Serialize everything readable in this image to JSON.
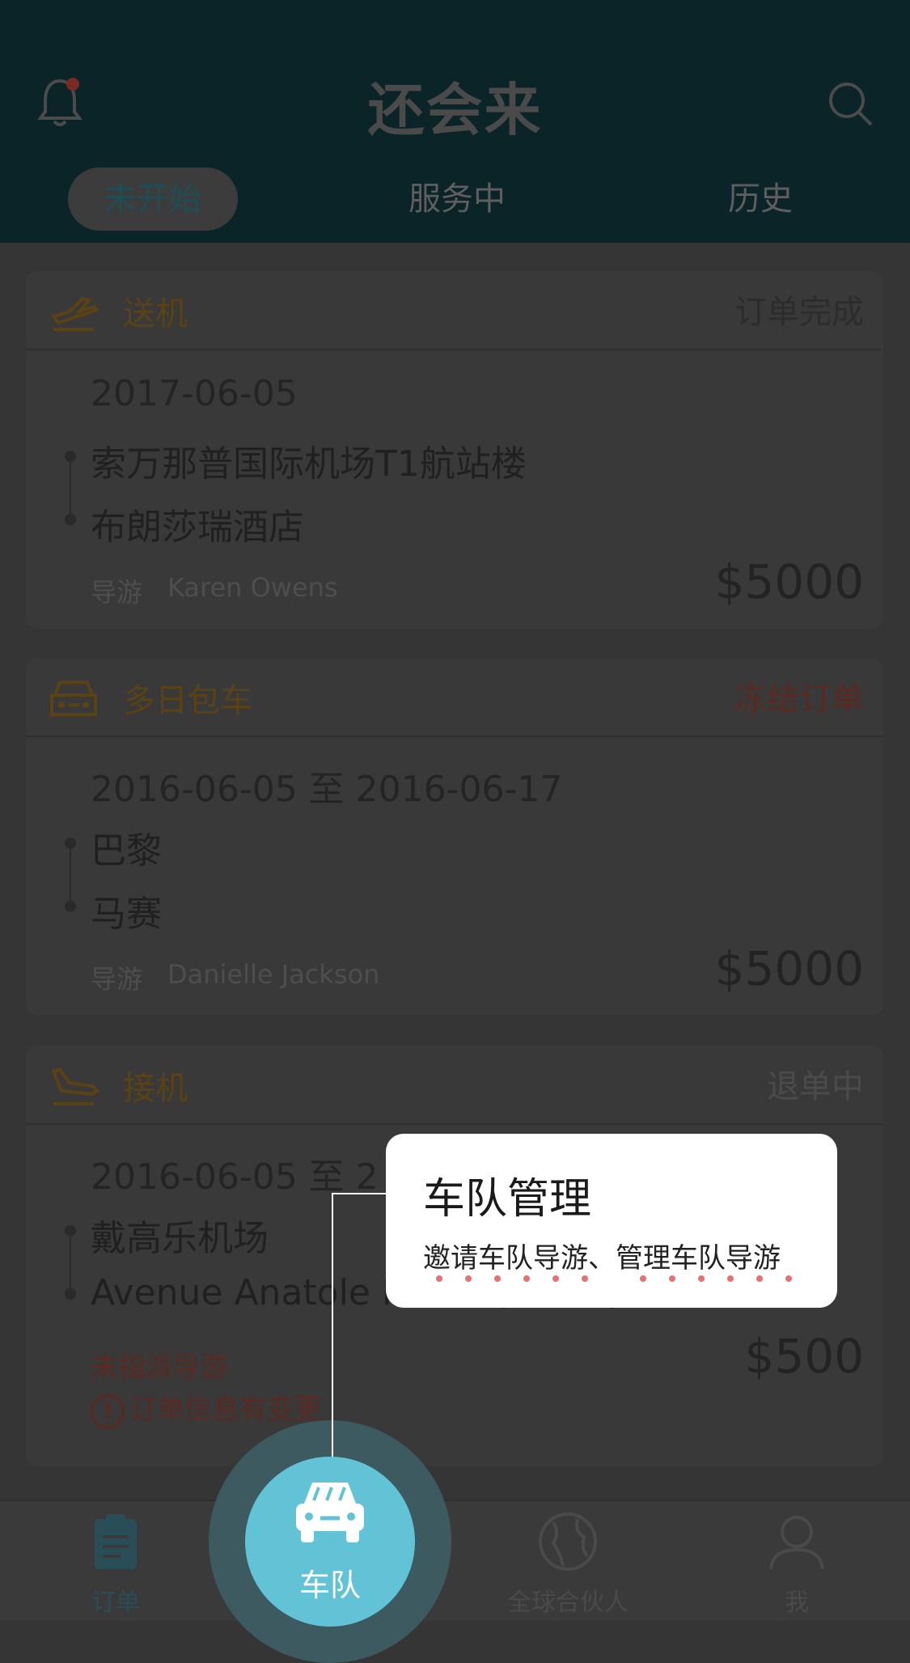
{
  "header": {
    "title": "还会来",
    "tabs": [
      "未开始",
      "服务中",
      "历史"
    ]
  },
  "orders": [
    {
      "type": "送机",
      "status": "订单完成",
      "date": "2017-06-05",
      "from": "索万那普国际机场T1航站楼",
      "to": "布朗莎瑞酒店",
      "guide_label": "导游",
      "guide_name": "Karen Owens",
      "price": "$5000"
    },
    {
      "type": "多日包车",
      "status": "冻结订单",
      "date": "2016-06-05 至 2016-06-17",
      "from": "巴黎",
      "to": "马赛",
      "guide_label": "导游",
      "guide_name": "Danielle Jackson",
      "price": "$5000"
    },
    {
      "type": "接机",
      "status": "退单中",
      "date": "2016-06-05 至 2",
      "from": "戴高乐机场",
      "to": "Avenue Anatole France, Paris, France",
      "unassigned": "未指派导游",
      "changed": "订单信息有变更",
      "price": "$500"
    }
  ],
  "tabbar": {
    "orders": "订单",
    "fleet": "车队",
    "partners": "全球合伙人",
    "me": "我"
  },
  "tooltip": {
    "title": "车队管理",
    "subtitle": "邀请车队导游、管理车队导游"
  },
  "colors": {
    "header_bg": "#0a2428",
    "accent": "#62c3d6",
    "highlight_dots": "#e57373"
  }
}
